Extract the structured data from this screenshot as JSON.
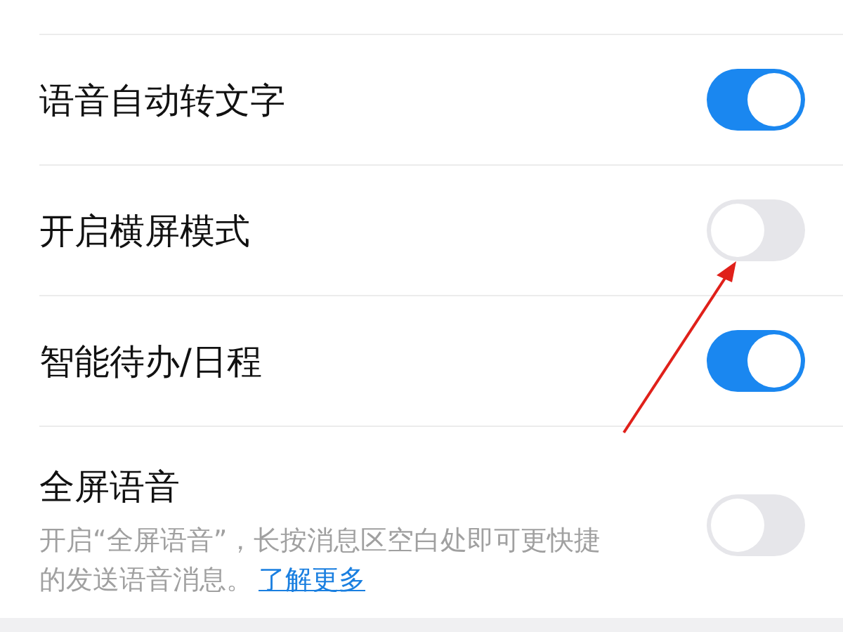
{
  "settings": [
    {
      "label": "语音自动转文字",
      "on": true
    },
    {
      "label": "开启横屏模式",
      "on": false
    },
    {
      "label": "智能待办/日程",
      "on": true
    },
    {
      "label": "全屏语音",
      "on": false,
      "description": "开启“全屏语音”，长按消息区空白处即可更快捷的发送语音消息。",
      "link": "了解更多"
    }
  ]
}
